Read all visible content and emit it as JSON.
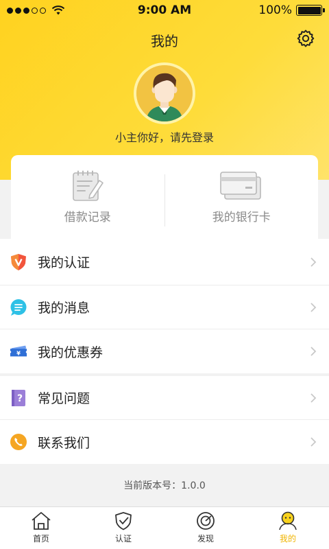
{
  "status_bar": {
    "time": "9:00 AM",
    "battery_text": "100%",
    "signal_icon": "signal-dots-icon",
    "wifi_icon": "wifi-icon",
    "battery_icon": "battery-icon"
  },
  "header": {
    "title": "我的",
    "settings_icon": "gear-icon",
    "avatar_icon": "avatar-icon",
    "greeting": "小主你好，请先登录"
  },
  "quick_card": {
    "items": [
      {
        "label": "借款记录",
        "icon": "notepad-icon"
      },
      {
        "label": "我的银行卡",
        "icon": "bank-card-icon"
      }
    ]
  },
  "menu": {
    "group1": [
      {
        "label": "我的认证",
        "icon": "shield-v-icon",
        "icon_color": "#f2553c"
      },
      {
        "label": "我的消息",
        "icon": "chat-bubble-icon",
        "icon_color": "#2ec1e6"
      },
      {
        "label": "我的优惠券",
        "icon": "coupon-ticket-icon",
        "icon_color": "#2f6fd6"
      }
    ],
    "group2": [
      {
        "label": "常见问题",
        "icon": "question-book-icon",
        "icon_color": "#9b7fd8"
      },
      {
        "label": "联系我们",
        "icon": "phone-icon",
        "icon_color": "#f5a623"
      }
    ]
  },
  "version_text": "当前版本号：1.0.0",
  "tabbar": {
    "tabs": [
      {
        "label": "首页",
        "icon": "home-icon",
        "active": false
      },
      {
        "label": "认证",
        "icon": "shield-check-icon",
        "active": false
      },
      {
        "label": "发现",
        "icon": "discover-icon",
        "active": false
      },
      {
        "label": "我的",
        "icon": "profile-icon",
        "active": true
      }
    ],
    "active_color": "#f0b400"
  },
  "colors": {
    "header_gradient_start": "#ffd21f",
    "header_gradient_end": "#ffe36a",
    "accent": "#f0b400"
  }
}
